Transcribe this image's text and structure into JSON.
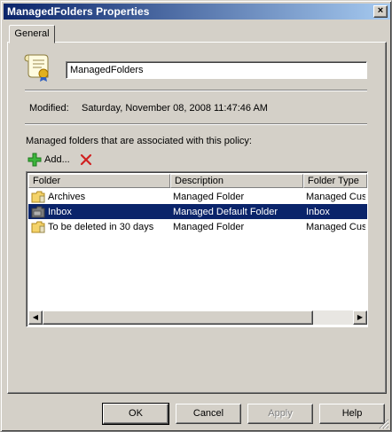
{
  "window": {
    "title": "ManagedFolders Properties",
    "close_glyph": "×"
  },
  "tabs": [
    {
      "label": "General",
      "selected": true
    }
  ],
  "general": {
    "name_value": "ManagedFolders",
    "modified_label": "Modified:",
    "modified_value": "Saturday, November 08, 2008 11:47:46 AM",
    "assoc_label": "Managed folders that are associated with this policy:",
    "add_label": "Add...",
    "list": {
      "columns": [
        "Folder",
        "Description",
        "Folder Type"
      ],
      "rows": [
        {
          "folder": "Archives",
          "description": "Managed Folder",
          "type": "Managed Custom",
          "icon": "managed-folder-icon",
          "selected": false
        },
        {
          "folder": "Inbox",
          "description": "Managed Default Folder",
          "type": "Inbox",
          "icon": "default-folder-icon",
          "selected": true
        },
        {
          "folder": "To be deleted in 30 days",
          "description": "Managed Folder",
          "type": "Managed Custom",
          "icon": "managed-folder-icon",
          "selected": false
        }
      ]
    }
  },
  "buttons": {
    "ok": "OK",
    "cancel": "Cancel",
    "apply": "Apply",
    "help": "Help"
  },
  "colors": {
    "title_start": "#0a246a",
    "title_end": "#a6caf0",
    "selection": "#0a246a",
    "face": "#d4d0c8"
  }
}
